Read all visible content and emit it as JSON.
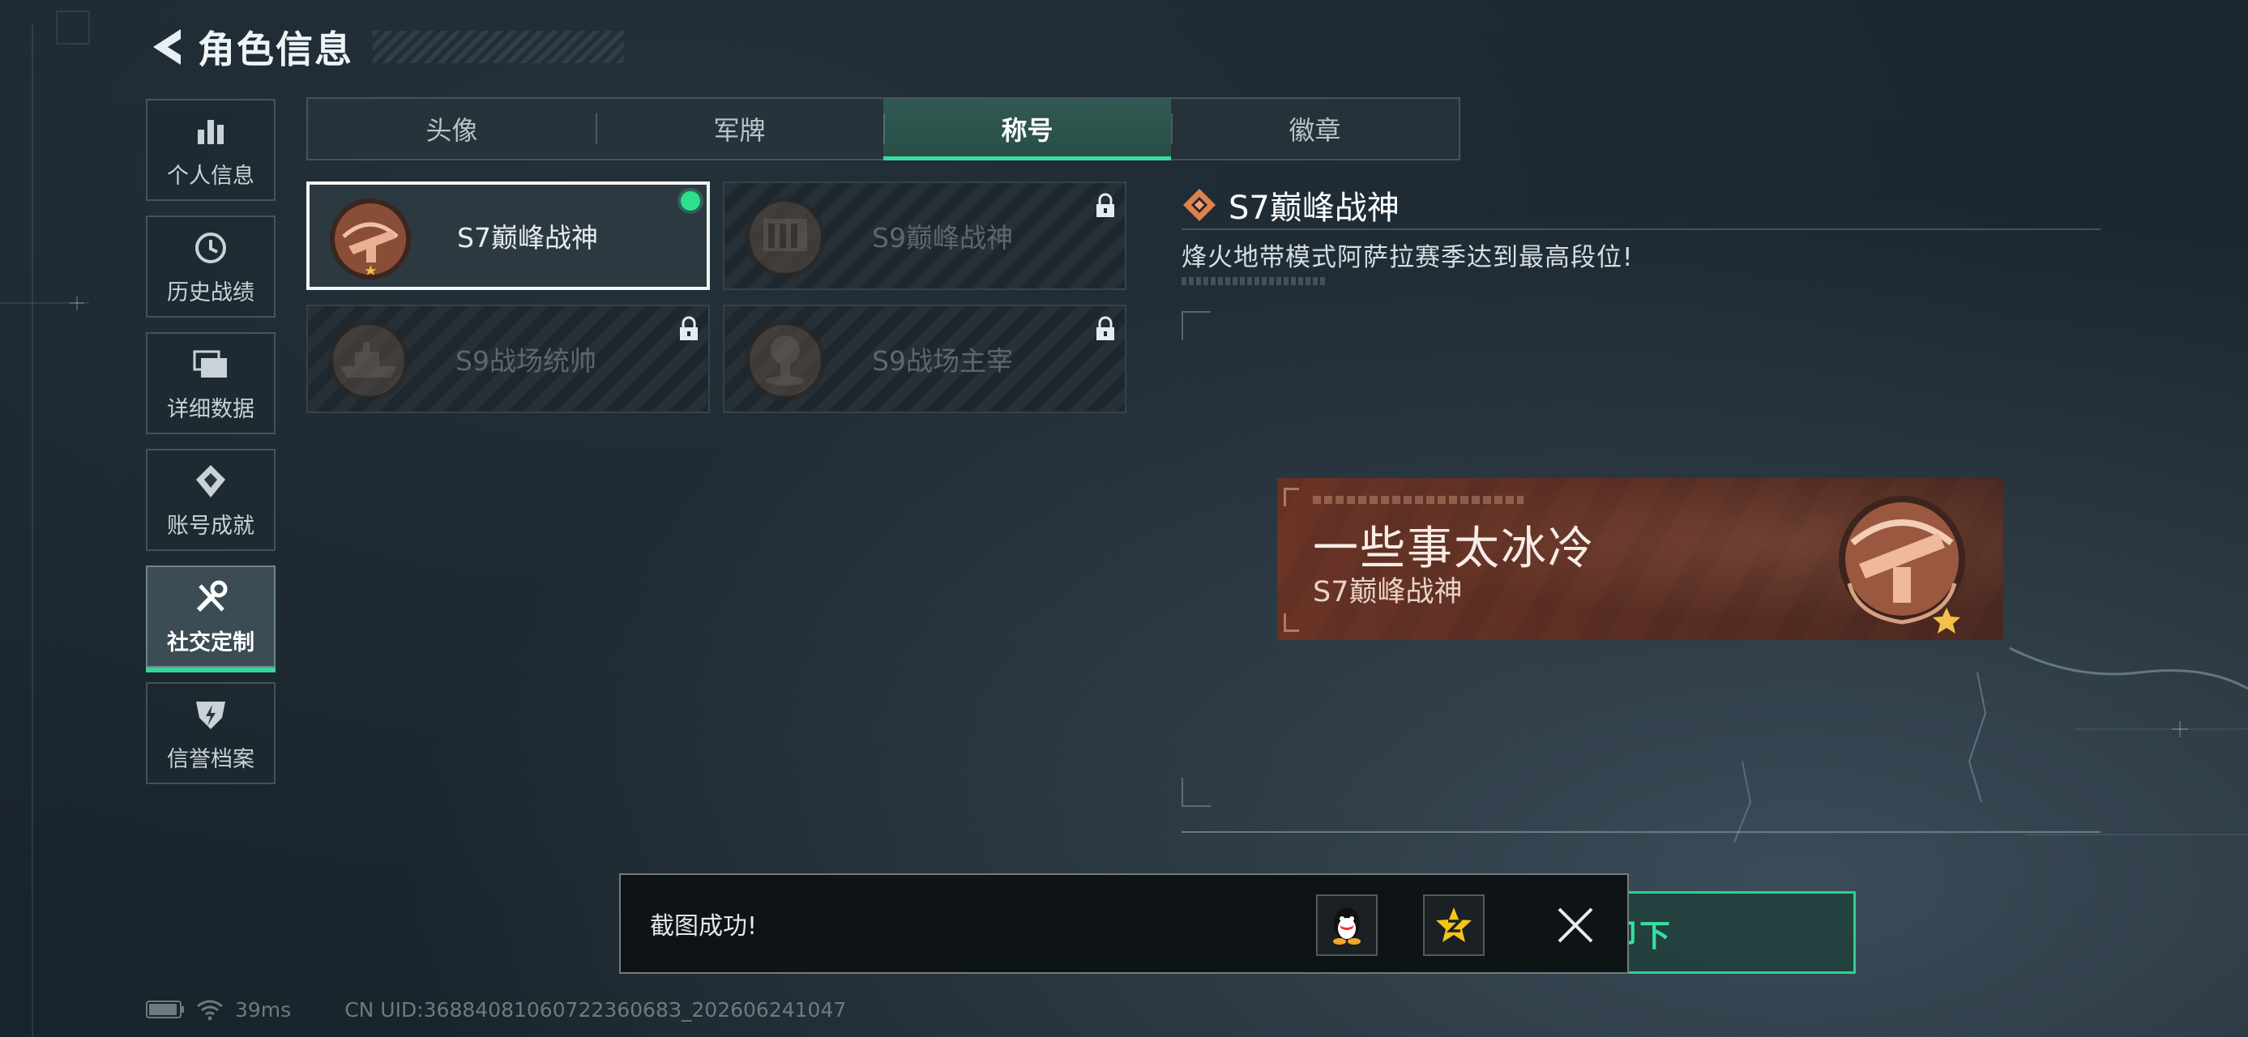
{
  "header": {
    "title": "角色信息"
  },
  "sidebar": {
    "items": [
      {
        "label": "个人信息",
        "icon": "bar-chart-icon"
      },
      {
        "label": "历史战绩",
        "icon": "clock-history-icon"
      },
      {
        "label": "详细数据",
        "icon": "stacked-folders-icon"
      },
      {
        "label": "账号成就",
        "icon": "achievement-badge-icon"
      },
      {
        "label": "社交定制",
        "icon": "tools-wrench-icon",
        "active": true
      },
      {
        "label": "信誉档案",
        "icon": "reputation-shield-icon"
      }
    ]
  },
  "tabs": [
    {
      "label": "头像"
    },
    {
      "label": "军牌"
    },
    {
      "label": "称号",
      "active": true
    },
    {
      "label": "徽章"
    }
  ],
  "titles": [
    {
      "name": "S7巅峰战神",
      "locked": false,
      "selected": true,
      "equipped": true
    },
    {
      "name": "S9巅峰战神",
      "locked": true
    },
    {
      "name": "S9战场统帅",
      "locked": true
    },
    {
      "name": "S9战场主宰",
      "locked": true
    }
  ],
  "detail": {
    "title": "S7巅峰战神",
    "description": "烽火地带模式阿萨拉赛季达到最高段位!"
  },
  "preview": {
    "nickname": "一些事太冰冷",
    "title": "S7巅峰战神"
  },
  "action": {
    "unequip_label": "卸下"
  },
  "toast": {
    "message": "截图成功!",
    "share_targets": [
      "qq-penguin-icon",
      "qzone-star-icon"
    ]
  },
  "status_bar": {
    "ping": "39ms",
    "uid": "CN UID:3688408106072236068З_202606241047"
  },
  "colors": {
    "accent": "#37d69a",
    "equipped_dot": "#2ee08e",
    "preview_bg": "#6a3426",
    "medal_bronze": "#c88a6a",
    "diamond_icon": "#e0804a"
  }
}
